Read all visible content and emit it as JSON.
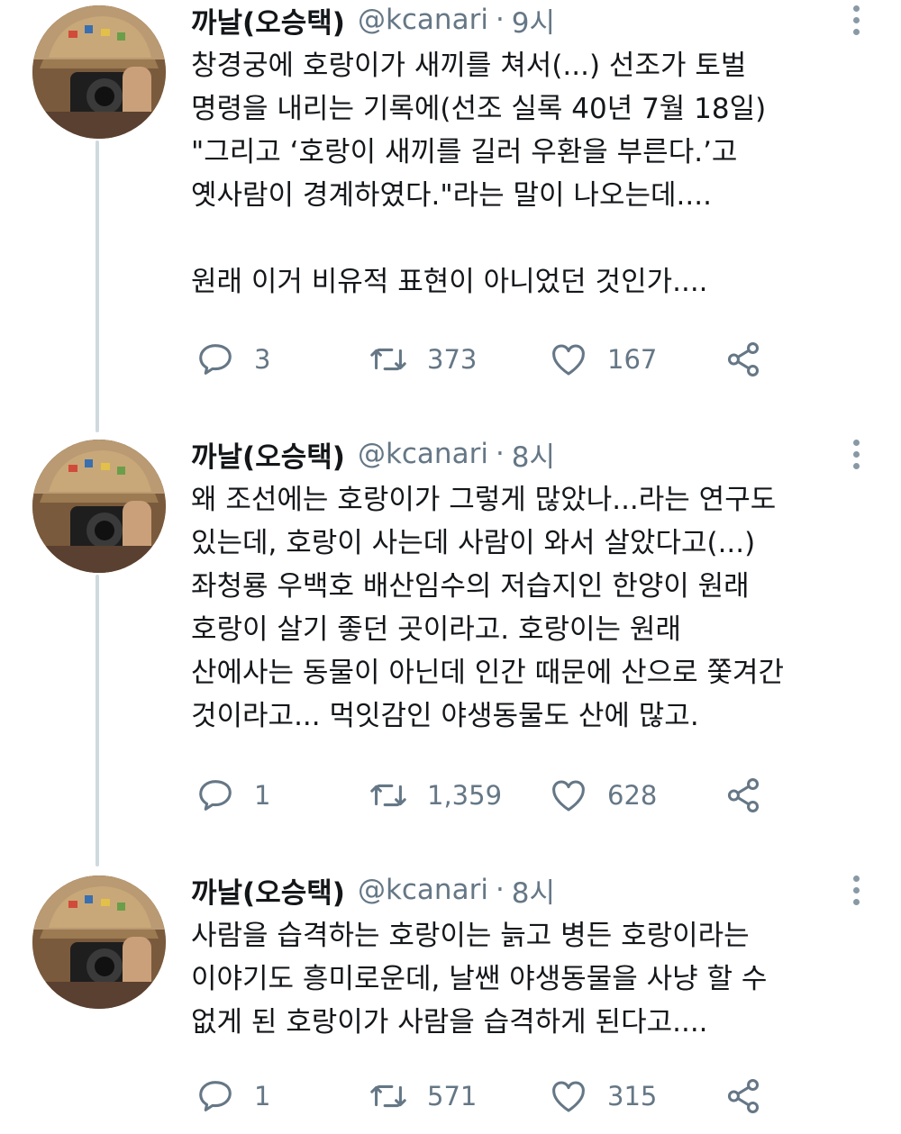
{
  "tweets": [
    {
      "name": "까날(오승택)",
      "handle": "@kcanari",
      "dot": "·",
      "time": "9시",
      "lines": [
        "창경궁에 호랑이가 새끼를 쳐서(...) 선조가 토벌",
        "명령을 내리는 기록에(선조 실록 40년 7월 18일)",
        "\"그리고 ‘호랑이 새끼를 길러 우환을 부른다.’고",
        "옛사람이 경계하였다.\"라는 말이 나오는데....",
        "",
        "원래 이거 비유적 표현이 아니었던 것인가...."
      ],
      "replies": "3",
      "retweets": "373",
      "likes": "167"
    },
    {
      "name": "까날(오승택)",
      "handle": "@kcanari",
      "dot": "·",
      "time": "8시",
      "lines": [
        "왜 조선에는 호랑이가 그렇게 많았나...라는 연구도",
        "있는데, 호랑이 사는데 사람이 와서 살았다고(...)",
        "좌청룡 우백호 배산임수의 저습지인 한양이 원래",
        "호랑이 살기 좋던 곳이라고. 호랑이는 원래",
        "산에사는 동물이 아닌데 인간 때문에 산으로 쫓겨간",
        "것이라고... 먹잇감인 야생동물도 산에 많고."
      ],
      "replies": "1",
      "retweets": "1,359",
      "likes": "628"
    },
    {
      "name": "까날(오승택)",
      "handle": "@kcanari",
      "dot": "·",
      "time": "8시",
      "lines": [
        "사람을 습격하는 호랑이는 늙고 병든 호랑이라는",
        "이야기도 흥미로운데, 날쌘 야생동물을 사냥 할 수",
        "없게 된 호랑이가 사람을 습격하게 된다고...."
      ],
      "replies": "1",
      "retweets": "571",
      "likes": "315"
    }
  ],
  "icons": {
    "reply": "reply-icon",
    "retweet": "retweet-icon",
    "like": "heart-icon",
    "share": "share-icon",
    "more": "more-vertical-icon"
  },
  "colors": {
    "text": "#14171a",
    "secondary": "#657786",
    "thread_line": "#cfd9de"
  }
}
